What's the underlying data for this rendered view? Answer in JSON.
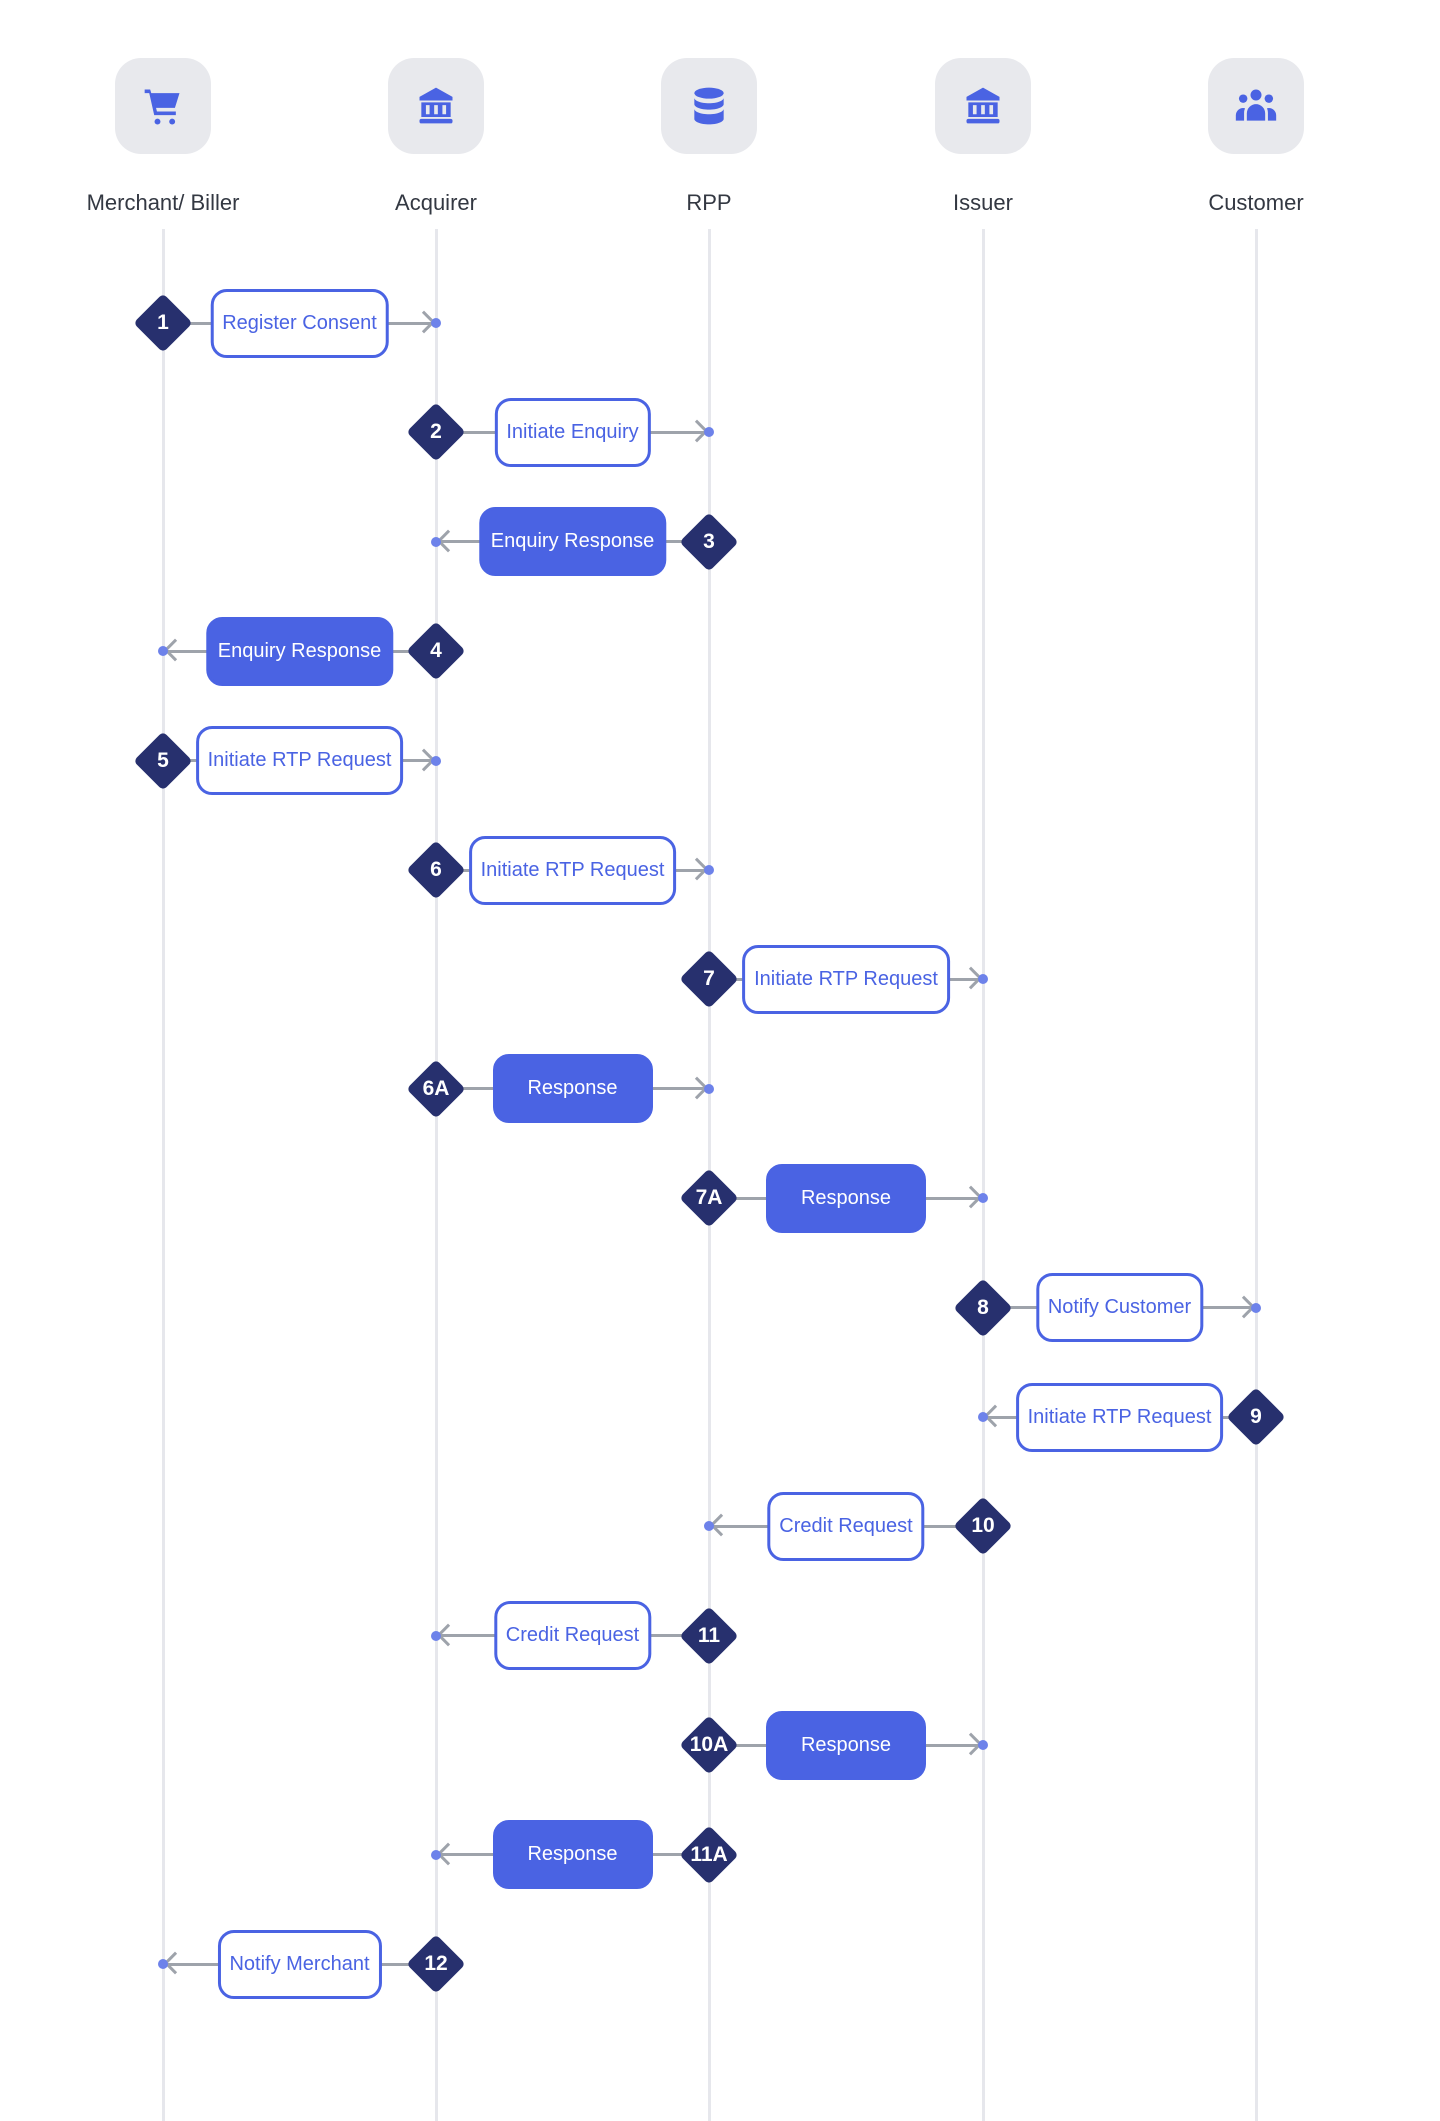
{
  "actors": [
    {
      "label": "Merchant/ Biller",
      "icon": "shopping-cart-icon"
    },
    {
      "label": "Acquirer",
      "icon": "bank-icon"
    },
    {
      "label": "RPP",
      "icon": "database-icon"
    },
    {
      "label": "Issuer",
      "icon": "bank-icon"
    },
    {
      "label": "Customer",
      "icon": "users-icon"
    }
  ],
  "steps": [
    {
      "number": "1",
      "label": "Register Consent",
      "style": "outline",
      "from": "Merchant/ Biller",
      "to": "Acquirer"
    },
    {
      "number": "2",
      "label": "Initiate Enquiry",
      "style": "outline",
      "from": "Acquirer",
      "to": "RPP"
    },
    {
      "number": "3",
      "label": "Enquiry Response",
      "style": "filled",
      "from": "RPP",
      "to": "Acquirer"
    },
    {
      "number": "4",
      "label": "Enquiry Response",
      "style": "filled",
      "from": "Acquirer",
      "to": "Merchant/ Biller"
    },
    {
      "number": "5",
      "label": "Initiate RTP Request",
      "style": "outline",
      "from": "Merchant/ Biller",
      "to": "Acquirer"
    },
    {
      "number": "6",
      "label": "Initiate RTP Request",
      "style": "outline",
      "from": "Acquirer",
      "to": "RPP"
    },
    {
      "number": "7",
      "label": "Initiate RTP Request",
      "style": "outline",
      "from": "RPP",
      "to": "Issuer"
    },
    {
      "number": "6A",
      "label": "Response",
      "style": "filled",
      "from": "Acquirer",
      "to": "RPP"
    },
    {
      "number": "7A",
      "label": "Response",
      "style": "filled",
      "from": "RPP",
      "to": "Issuer"
    },
    {
      "number": "8",
      "label": "Notify Customer",
      "style": "outline",
      "from": "Issuer",
      "to": "Customer"
    },
    {
      "number": "9",
      "label": "Initiate RTP Request",
      "style": "outline",
      "from": "Customer",
      "to": "Issuer"
    },
    {
      "number": "10",
      "label": "Credit Request",
      "style": "outline",
      "from": "Issuer",
      "to": "RPP"
    },
    {
      "number": "11",
      "label": "Credit Request",
      "style": "outline",
      "from": "RPP",
      "to": "Acquirer"
    },
    {
      "number": "10A",
      "label": "Response",
      "style": "filled",
      "from": "RPP",
      "to": "Issuer"
    },
    {
      "number": "11A",
      "label": "Response",
      "style": "filled",
      "from": "RPP",
      "to": "Acquirer"
    },
    {
      "number": "12",
      "label": "Notify Merchant",
      "style": "outline",
      "from": "Acquirer",
      "to": "Merchant/ Biller"
    }
  ],
  "colors": {
    "accent": "#4a63e3",
    "step_marker": "#27306e",
    "connector": "#9ea3ab",
    "tile": "#e8e9ed"
  }
}
